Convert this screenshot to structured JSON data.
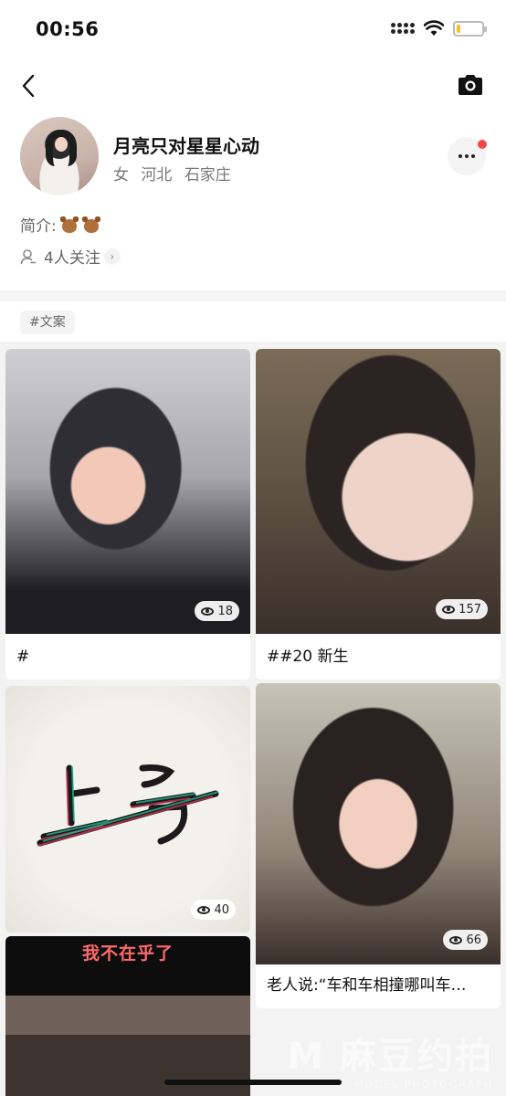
{
  "status_bar": {
    "time": "00:56"
  },
  "profile": {
    "nickname": "月亮只对星星心动",
    "gender": "女",
    "province": "河北",
    "city": "石家庄",
    "intro_label": "简介:",
    "following": "4人关注"
  },
  "tag": "#文案",
  "posts": [
    {
      "title": "#",
      "views": "18"
    },
    {
      "title": "##20 新生",
      "views": "157"
    },
    {
      "title": "",
      "views": "40"
    },
    {
      "title": "老人说:“车和车相撞哪叫车…",
      "views": "66"
    },
    {
      "title": "",
      "overlay": "我不在乎了"
    }
  ],
  "watermark": {
    "main": "M 麻豆约拍",
    "sub": "MODEL PHOTOGRAPH"
  },
  "colors": {
    "notification_dot": "#ef4a4a",
    "feed_background": "#f3f3f3"
  }
}
